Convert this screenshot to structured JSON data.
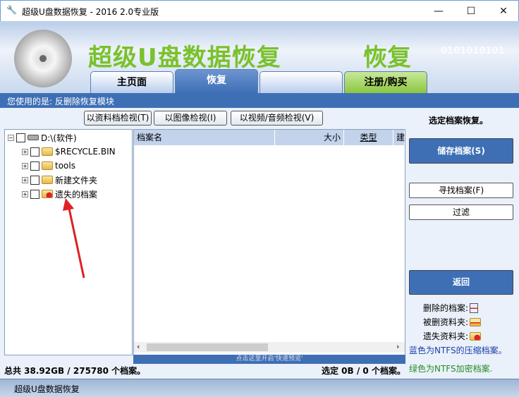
{
  "window": {
    "title": "超级U盘数据恢复 - 2016 2.0专业版",
    "minimize": "—",
    "maximize": "☐",
    "close": "✕"
  },
  "banner": {
    "logo": "超级U盘数据恢复",
    "logo_tail": "恢复",
    "binary": "0101010101"
  },
  "tabs": [
    {
      "label": "主页面"
    },
    {
      "label": "恢复"
    },
    {
      "label": ""
    },
    {
      "label": "注册/购买"
    }
  ],
  "module_strip": "您使用的是: 反删除恢复模块",
  "view_buttons": [
    "以资料档检视(T)",
    "以图像检视(I)",
    "以视频/音频检视(V)"
  ],
  "tree": {
    "root": "D:\\(软件)",
    "items": [
      "$RECYCLE.BIN",
      "tools",
      "新建文件夹",
      "遗失的档案"
    ]
  },
  "list": {
    "columns": [
      "档案名",
      "大小",
      "类型",
      "建"
    ]
  },
  "quick_preview": "点击这里开启'快速预览'",
  "right": {
    "heading": "选定档案恢复。",
    "save": "储存档案(S)",
    "find": "寻找档案(F)",
    "filter": "过滤",
    "back": "返回",
    "legend": [
      "删除的档案:",
      "被删资料夹:",
      "遗失资料夹:"
    ],
    "ntfs_compressed": "蓝色为NTFS的压缩档案。",
    "ntfs_encrypted": "绿色为NTFS加密档案."
  },
  "status": {
    "total": "总共 38.92GB / 275780 个档案。",
    "selected": "选定 0B / 0 个档案。"
  },
  "statusbar": "超级U盘数据恢复",
  "colors": {
    "accent": "#3e6fb5",
    "logo": "#7ac12b",
    "register_tab": "#8cc63f"
  }
}
